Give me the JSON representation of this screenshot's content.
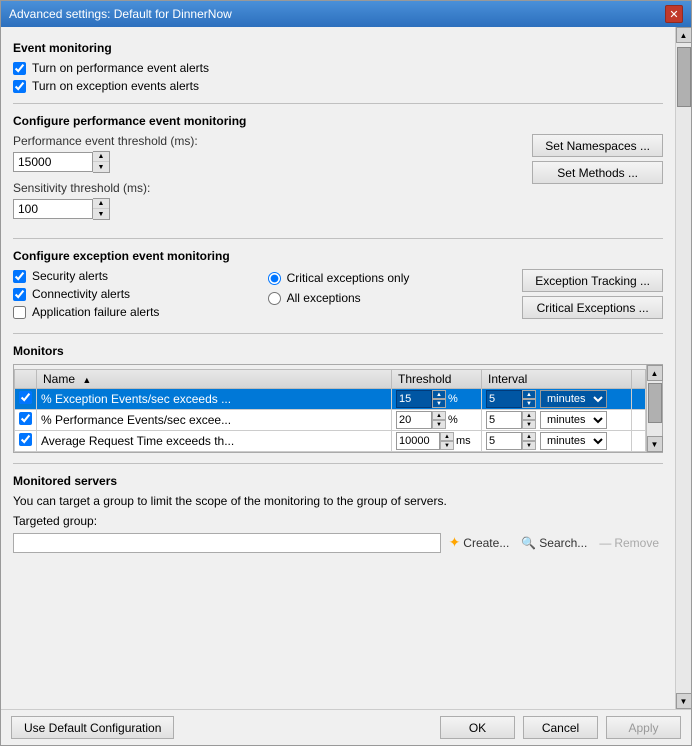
{
  "window": {
    "title": "Advanced settings: Default for DinnerNow",
    "close_label": "✕"
  },
  "sections": {
    "event_monitoring": {
      "title": "Event monitoring",
      "checkboxes": [
        {
          "id": "chk_perf",
          "label": "Turn on performance event alerts",
          "checked": true
        },
        {
          "id": "chk_exc",
          "label": "Turn on exception events alerts",
          "checked": true
        }
      ]
    },
    "perf_config": {
      "title": "Configure performance event monitoring",
      "perf_threshold_label": "Performance event threshold (ms):",
      "perf_threshold_value": "15000",
      "sensitivity_label": "Sensitivity threshold (ms):",
      "sensitivity_value": "100",
      "btn_namespaces": "Set Namespaces ...",
      "btn_methods": "Set Methods ..."
    },
    "exception_config": {
      "title": "Configure exception event monitoring",
      "checkboxes": [
        {
          "id": "chk_security",
          "label": "Security alerts",
          "checked": true
        },
        {
          "id": "chk_connectivity",
          "label": "Connectivity alerts",
          "checked": true
        },
        {
          "id": "chk_appfailure",
          "label": "Application failure alerts",
          "checked": false
        }
      ],
      "radios": [
        {
          "id": "rad_critical",
          "label": "Critical exceptions only",
          "checked": true
        },
        {
          "id": "rad_all",
          "label": "All exceptions",
          "checked": false
        }
      ],
      "btn_exception_tracking": "Exception Tracking ...",
      "btn_critical_exceptions": "Critical Exceptions ..."
    },
    "monitors": {
      "title": "Monitors",
      "columns": [
        "Name",
        "Threshold",
        "Interval"
      ],
      "rows": [
        {
          "checked": true,
          "name": "% Exception Events/sec exceeds ...",
          "threshold": "15",
          "unit": "%",
          "interval": "5",
          "interval_unit": "minutes",
          "selected": true
        },
        {
          "checked": true,
          "name": "% Performance Events/sec excee...",
          "threshold": "20",
          "unit": "%",
          "interval": "5",
          "interval_unit": "minutes",
          "selected": false
        },
        {
          "checked": true,
          "name": "Average Request Time exceeds th...",
          "threshold": "10000",
          "unit": "ms",
          "interval": "5",
          "interval_unit": "minutes",
          "selected": false
        }
      ]
    },
    "monitored_servers": {
      "title": "Monitored servers",
      "description": "You can target a group to limit the scope of the monitoring to the group of servers.",
      "targeted_group_label": "Targeted group:",
      "create_label": "Create...",
      "search_label": "Search...",
      "remove_label": "Remove"
    }
  },
  "bottom_bar": {
    "use_default": "Use Default Configuration",
    "ok": "OK",
    "cancel": "Cancel",
    "apply": "Apply"
  }
}
